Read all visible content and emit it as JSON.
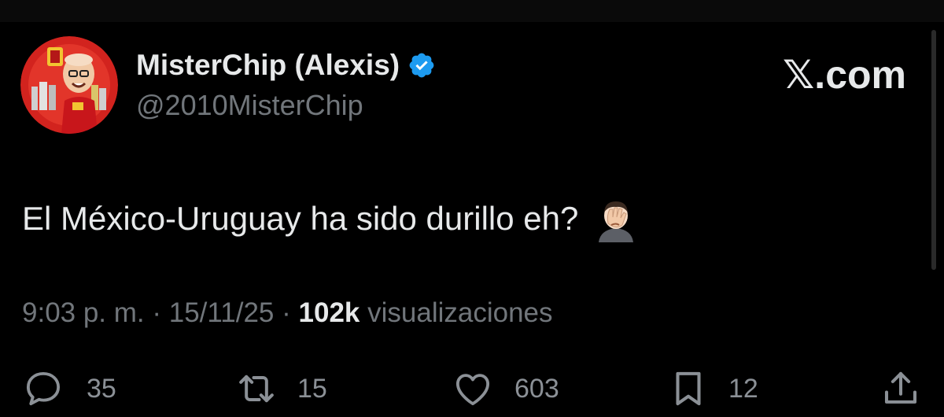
{
  "post": {
    "display_name": "MisterChip (Alexis)",
    "handle": "@2010MisterChip",
    "brand": "𝕏.com",
    "text": "El México-Uruguay ha sido durillo eh?",
    "emoji": "face-palm-emoji",
    "time": "9:03 p. m.",
    "separator": " · ",
    "date": "15/11/25",
    "views_count": "102k",
    "views_label": " visualizaciones"
  },
  "actions": {
    "replies": "35",
    "reposts": "15",
    "likes": "603",
    "bookmarks": "12"
  },
  "colors": {
    "background": "#000000",
    "text_primary": "#e7e9ea",
    "text_secondary": "#71767b",
    "verified_blue": "#1d9bf0",
    "avatar_red": "#d2231e"
  },
  "icons": [
    "verified-badge-icon",
    "reply-icon",
    "repost-icon",
    "like-icon",
    "bookmark-icon",
    "share-icon"
  ]
}
